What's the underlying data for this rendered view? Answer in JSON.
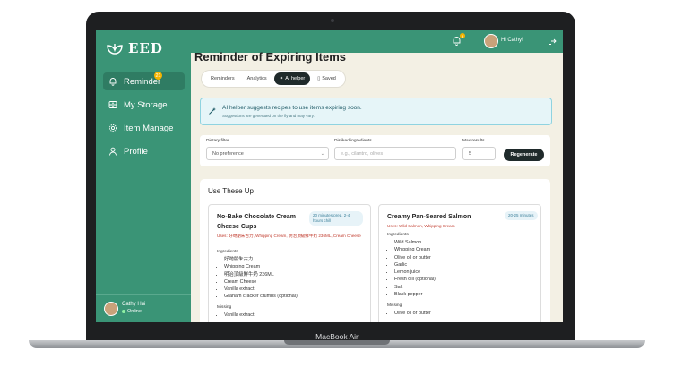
{
  "device": {
    "label": "MacBook Air"
  },
  "sidebar": {
    "logo": "EED",
    "items": [
      {
        "label": "Reminder",
        "icon": "bell-icon",
        "badge": "21",
        "active": true
      },
      {
        "label": "My Storage",
        "icon": "storage-icon"
      },
      {
        "label": "Item Manage",
        "icon": "gear-icon"
      },
      {
        "label": "Profile",
        "icon": "user-icon"
      }
    ],
    "user": {
      "name": "Cathy Hui",
      "status": "Online"
    }
  },
  "topbar": {
    "notification_badge": "3",
    "greeting": "Hi Cathy!",
    "logout_icon": "logout-icon"
  },
  "page": {
    "title": "Reminder of Expiring Items",
    "tabs": [
      {
        "label": "Reminders"
      },
      {
        "label": "Analytics"
      },
      {
        "label": "AI helper",
        "active": true
      },
      {
        "label": "Saved"
      }
    ]
  },
  "alert": {
    "title": "AI helper suggests recipes to use items expiring soon.",
    "subtitle": "Suggestions are generated on the fly and may vary."
  },
  "filters": {
    "dietary_label": "Dietary filter",
    "dietary_value": "No preference",
    "disliked_label": "Disliked ingredients",
    "disliked_placeholder": "e.g., cilantro, olives",
    "max_label": "Max results",
    "max_value": "5",
    "regenerate": "Regenerate"
  },
  "use_these_up": {
    "title": "Use These Up",
    "recipes": [
      {
        "title": "No-Bake Chocolate Cream Cheese Cups",
        "time": "20 minutes prep, 2-4 hours chill",
        "uses": "Uses: 好哋朋朱古力, Whipping Cream, 明治頂級鮮牛奶 236ML, Cream Cheese",
        "ingredients_label": "Ingredients",
        "ingredients": [
          "好哋朋朱古力",
          "Whipping Cream",
          "明治頂級鮮牛奶 236ML",
          "Cream Cheese",
          "Vanilla extract",
          "Graham cracker crumbs (optional)"
        ],
        "missing_label": "Missing",
        "missing": [
          "Vanilla extract"
        ]
      },
      {
        "title": "Creamy Pan-Seared Salmon",
        "time": "20-25 minutes",
        "uses": "Uses: Wild Salmon, Whipping Cream",
        "ingredients_label": "Ingredients",
        "ingredients": [
          "Wild Salmon",
          "Whipping Cream",
          "Olive oil or butter",
          "Garlic",
          "Lemon juice",
          "Fresh dill (optional)",
          "Salt",
          "Black pepper"
        ],
        "missing_label": "Missing",
        "missing": [
          "Olive oil or butter"
        ]
      }
    ]
  }
}
